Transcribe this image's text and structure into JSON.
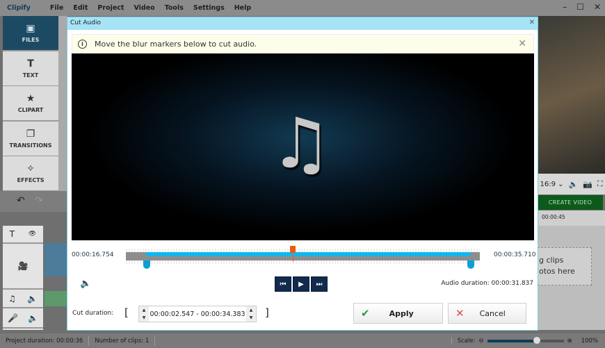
{
  "app": {
    "title": "Clipify",
    "menu": [
      "File",
      "Edit",
      "Project",
      "Video",
      "Tools",
      "Settings",
      "Help"
    ]
  },
  "sidebar": {
    "items": [
      {
        "label": "FILES",
        "icon": "image-icon",
        "glyph": "▣"
      },
      {
        "label": "TEXT",
        "icon": "text-icon",
        "glyph": "T"
      },
      {
        "label": "CLIPART",
        "icon": "star-icon",
        "glyph": "★"
      },
      {
        "label": "TRANSITIONS",
        "icon": "transitions-icon",
        "glyph": "❐"
      },
      {
        "label": "EFFECTS",
        "icon": "magic-wand-icon",
        "glyph": "✧"
      }
    ]
  },
  "right_panel": {
    "aspect": "16:9 ⌄",
    "create_video": "CREATE VIDEO",
    "ruler_time": "00:00:45",
    "dropzone_line1": "g clips",
    "dropzone_line2": "otos here"
  },
  "dialog": {
    "title": "Cut Audio",
    "info": "Move the blur markers below to cut audio.",
    "start_time": "00:00:16.754",
    "end_time": "00:00:35.710",
    "audio_duration": "Audio duration: 00:00:31.837",
    "cut_label": "Cut duration:",
    "cut_range": "00:00:02.547 - 00:00:34.383",
    "apply": "Apply",
    "cancel": "Cancel",
    "colors": {
      "selection": "#12b6ee",
      "playhead": "#ee5a14",
      "title_bar": "#a6e3f6"
    }
  },
  "status": {
    "project_duration": "Project duration:  00:00:36",
    "clips": "Number of clips: 1",
    "scale_label": "Scale:",
    "zoom": "100%",
    "scale_level": 0.65
  }
}
